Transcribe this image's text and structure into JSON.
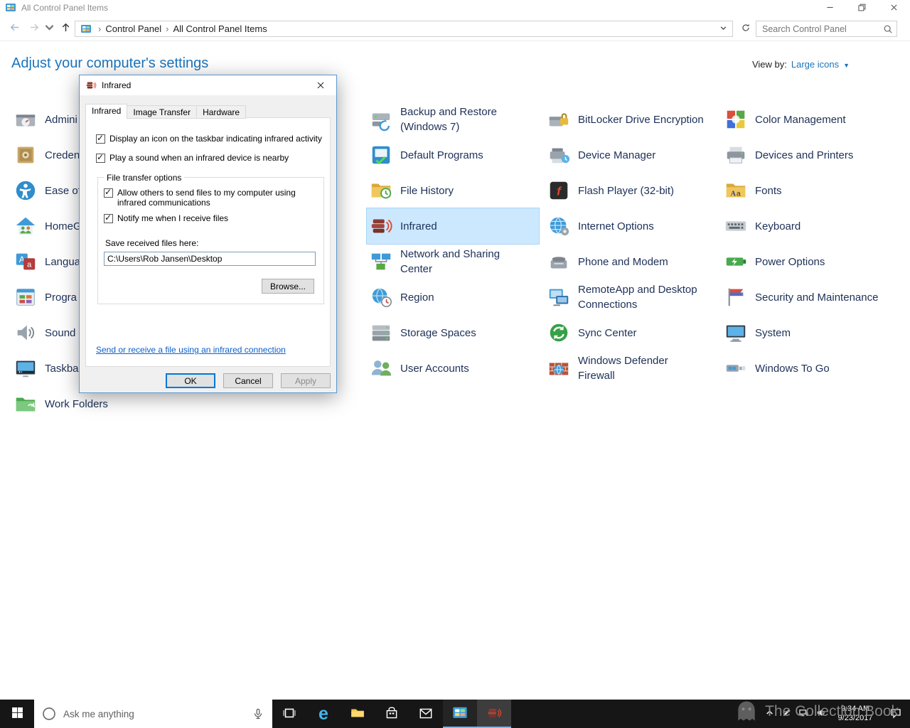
{
  "window": {
    "title": "All Control Panel Items"
  },
  "toolbar": {
    "breadcrumb_root": "Control Panel",
    "breadcrumb_current": "All Control Panel Items",
    "search_placeholder": "Search Control Panel"
  },
  "page": {
    "heading": "Adjust your computer's settings",
    "view_by_label": "View by:",
    "view_by_value": "Large icons"
  },
  "icons": {
    "check": "✓",
    "breadcrumb_separator": "›",
    "view_by_caret": "▼",
    "edge_glyph": "e"
  },
  "control_panel": {
    "columns": [
      {
        "items": [
          {
            "label": "Admini",
            "icon": "administrative-tools"
          },
          {
            "label": "Creden",
            "icon": "credential-manager"
          },
          {
            "label": "Ease of",
            "icon": "ease-of-access"
          },
          {
            "label": "HomeG",
            "icon": "homegroup"
          },
          {
            "label": "Langua",
            "icon": "language"
          },
          {
            "label": "Progra",
            "icon": "programs-features"
          },
          {
            "label": "Sound",
            "icon": "sound"
          },
          {
            "label": "Taskbar",
            "icon": "taskbar-navigation"
          },
          {
            "label": "Work Folders",
            "icon": "work-folders"
          }
        ]
      },
      {
        "items": [
          {
            "label": "Backup and Restore (Windows 7)",
            "icon": "backup-restore"
          },
          {
            "label": "Default Programs",
            "icon": "default-programs"
          },
          {
            "label": "File History",
            "icon": "file-history"
          },
          {
            "label": "Infrared",
            "icon": "infrared",
            "selected": true
          },
          {
            "label": "Network and Sharing Center",
            "icon": "network-sharing-center"
          },
          {
            "label": "Region",
            "icon": "region"
          },
          {
            "label": "Storage Spaces",
            "icon": "storage-spaces"
          },
          {
            "label": "User Accounts",
            "icon": "user-accounts"
          }
        ]
      },
      {
        "items": [
          {
            "label": "BitLocker Drive Encryption",
            "icon": "bitlocker"
          },
          {
            "label": "Device Manager",
            "icon": "device-manager"
          },
          {
            "label": "Flash Player (32-bit)",
            "icon": "flash-player"
          },
          {
            "label": "Internet Options",
            "icon": "internet-options"
          },
          {
            "label": "Phone and Modem",
            "icon": "phone-modem"
          },
          {
            "label": "RemoteApp and Desktop Connections",
            "icon": "remoteapp"
          },
          {
            "label": "Sync Center",
            "icon": "sync-center"
          },
          {
            "label": "Windows Defender Firewall",
            "icon": "defender-firewall"
          }
        ]
      },
      {
        "items": [
          {
            "label": "Color Management",
            "icon": "color-management"
          },
          {
            "label": "Devices and Printers",
            "icon": "devices-printers"
          },
          {
            "label": "Fonts",
            "icon": "fonts"
          },
          {
            "label": "Keyboard",
            "icon": "keyboard"
          },
          {
            "label": "Power Options",
            "icon": "power-options"
          },
          {
            "label": "Security and Maintenance",
            "icon": "security-maintenance"
          },
          {
            "label": "System",
            "icon": "system"
          },
          {
            "label": "Windows To Go",
            "icon": "windows-to-go"
          }
        ]
      }
    ]
  },
  "dialog": {
    "title": "Infrared",
    "tabs": [
      "Infrared",
      "Image Transfer",
      "Hardware"
    ],
    "checkboxes": {
      "taskbar_icon": "Display an icon on the taskbar indicating infrared activity",
      "play_sound": "Play a sound when an infrared device is nearby",
      "allow_send": "Allow others to send files to my computer using infrared communications",
      "notify": "Notify me when I receive files"
    },
    "group_title": "File transfer options",
    "save_label": "Save received files here:",
    "path_value": "C:\\Users\\Rob Jansen\\Desktop",
    "browse_label": "Browse...",
    "link_label": "Send or receive a file using an infrared connection",
    "buttons": {
      "ok": "OK",
      "cancel": "Cancel",
      "apply": "Apply"
    }
  },
  "taskbar": {
    "search_placeholder": "Ask me anything",
    "clock": {
      "time": "9:34 AM",
      "date": "9/23/2017"
    }
  },
  "watermark": "The Collection Book"
}
